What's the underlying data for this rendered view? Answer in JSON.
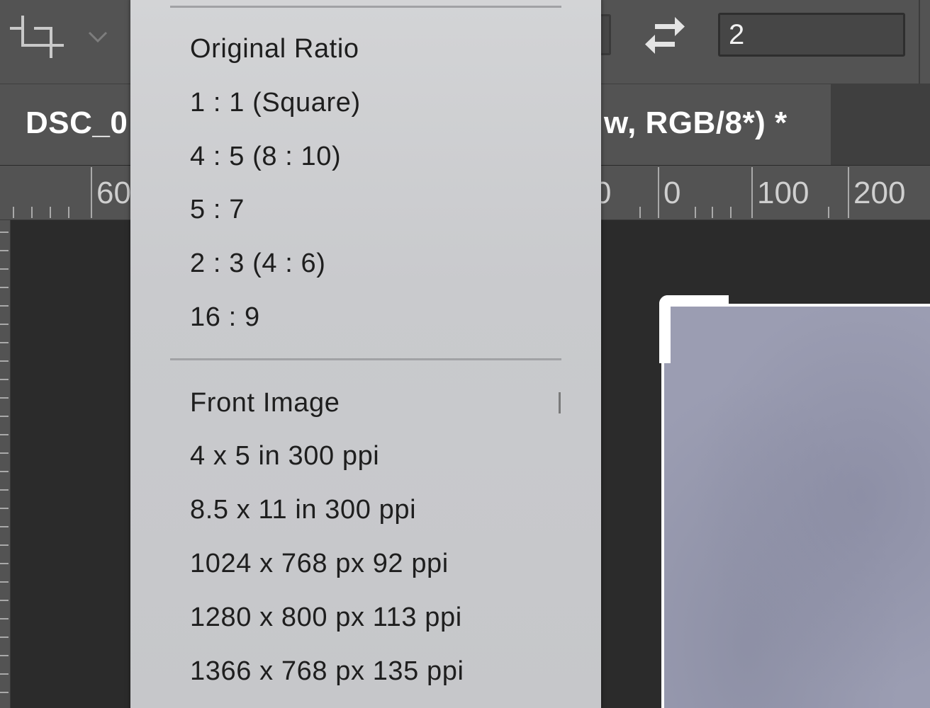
{
  "options_bar": {
    "crop_tool_icon": "crop-icon",
    "dropdown_icon": "chevron-down-icon",
    "swap_icon": "swap-arrows-icon",
    "ratio_height_value": "2"
  },
  "document_tab": {
    "title_visible_start": "DSC_0",
    "title_visible_end": "w, RGB/8*) *"
  },
  "ruler": {
    "labels": [
      "60",
      "0",
      "0",
      "100",
      "200"
    ]
  },
  "ratio_menu": {
    "preset_ratios": [
      "Original Ratio",
      "1 : 1 (Square)",
      "4 : 5 (8 : 10)",
      "5 : 7",
      "2 : 3 (4 : 6)",
      "16 : 9"
    ],
    "size_presets": [
      "Front Image",
      "4 x 5 in 300 ppi",
      "8.5 x 11 in 300 ppi",
      "1024 x 768 px 92 ppi",
      "1280 x 800 px 113 ppi",
      "1366 x 768 px 135 ppi"
    ]
  },
  "colors": {
    "toolbar": "#535353",
    "canvas": "#2b2b2b",
    "menu_bg": "#cbcccf",
    "menu_text": "#1e1e1e",
    "photo": "#9b9db2"
  }
}
